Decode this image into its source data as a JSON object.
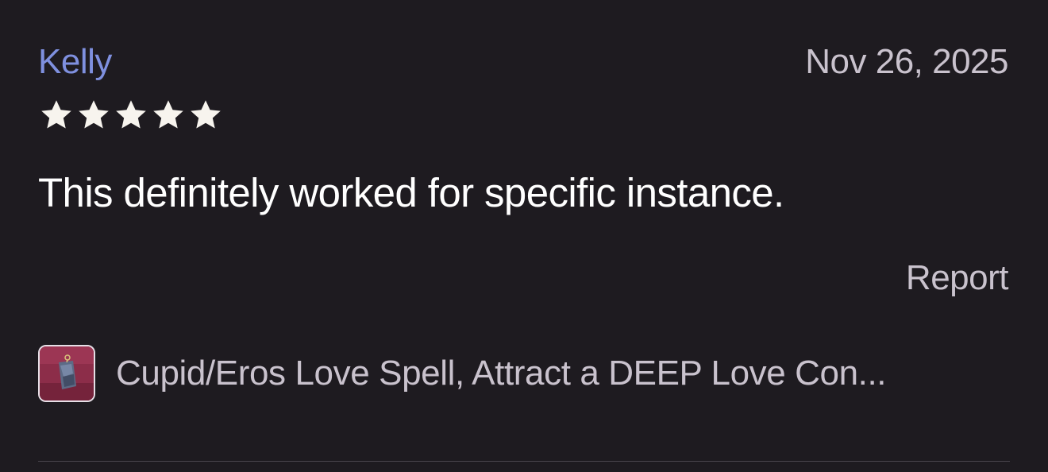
{
  "review": {
    "reviewer_name": "Kelly",
    "date": "Nov 26, 2025",
    "rating": 5,
    "rating_max": 5,
    "body": "This definitely worked for specific instance.",
    "report_label": "Report",
    "product": {
      "title": "Cupid/Eros Love Spell,  Attract a DEEP Love Con...",
      "thumbnail_icon": "product-thumbnail"
    }
  },
  "colors": {
    "background": "#1e1b20",
    "reviewer_name": "#7f90df",
    "secondary_text": "#c9c2cd",
    "primary_text": "#ffffff",
    "star": "#f7f4ee"
  }
}
